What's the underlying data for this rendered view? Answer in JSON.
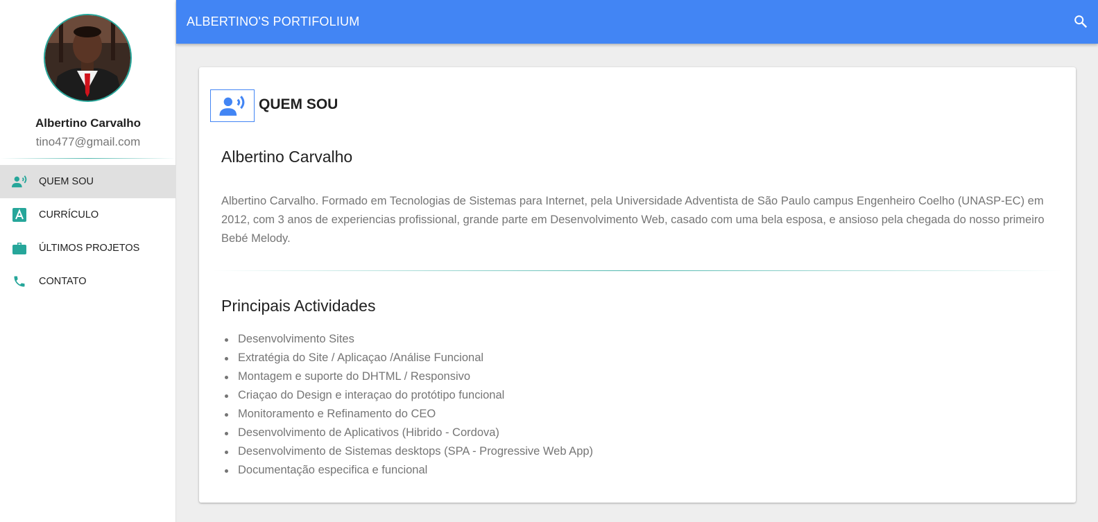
{
  "profile": {
    "name": "Albertino Carvalho",
    "email": "tino477@gmail.com",
    "photo_icon": "profile-photo"
  },
  "nav": {
    "items": [
      {
        "label": "QUEM SOU",
        "icon": "record-voice-icon",
        "active": true
      },
      {
        "label": "CURRÍCULO",
        "icon": "letter-a-icon",
        "active": false
      },
      {
        "label": "ÚLTIMOS PROJETOS",
        "icon": "briefcase-icon",
        "active": false
      },
      {
        "label": "CONTATO",
        "icon": "phone-icon",
        "active": false
      }
    ]
  },
  "appbar": {
    "title": "ALBERTINO'S PORTIFOLIUM",
    "search_icon": "search-icon"
  },
  "main": {
    "section_title": "QUEM SOU",
    "section_icon": "record-voice-icon",
    "name_heading": "Albertino Carvalho",
    "bio": "Albertino Carvalho. Formado em Tecnologias de Sistemas para Internet, pela Universidade Adventista de São Paulo campus Engenheiro Coelho (UNASP-EC) em 2012, com 3 anos de experiencias profissional, grande parte em Desenvolvimento Web, casado com uma bela esposa, e ansioso pela chegada do nosso primeiro Bebé Melody.",
    "activities_heading": "Principais Actividades",
    "activities": [
      "Desenvolvimento Sites",
      "Extratégia do Site / Aplicaçao /Análise Funcional",
      "Montagem e suporte do DHTML / Responsivo",
      "Criaçao do Design e interaçao do protótipo funcional",
      "Monitoramento e Refinamento do CEO",
      "Desenvolvimento de Aplicativos (Hibrido - Cordova)",
      "Desenvolvimento de Sistemas desktops (SPA - Progressive Web App)",
      "Documentação especifica e funcional"
    ]
  },
  "colors": {
    "primary": "#4285f4",
    "accent": "#26a69a",
    "active_nav_bg": "#e0e0e0",
    "background": "#eeeeee"
  }
}
